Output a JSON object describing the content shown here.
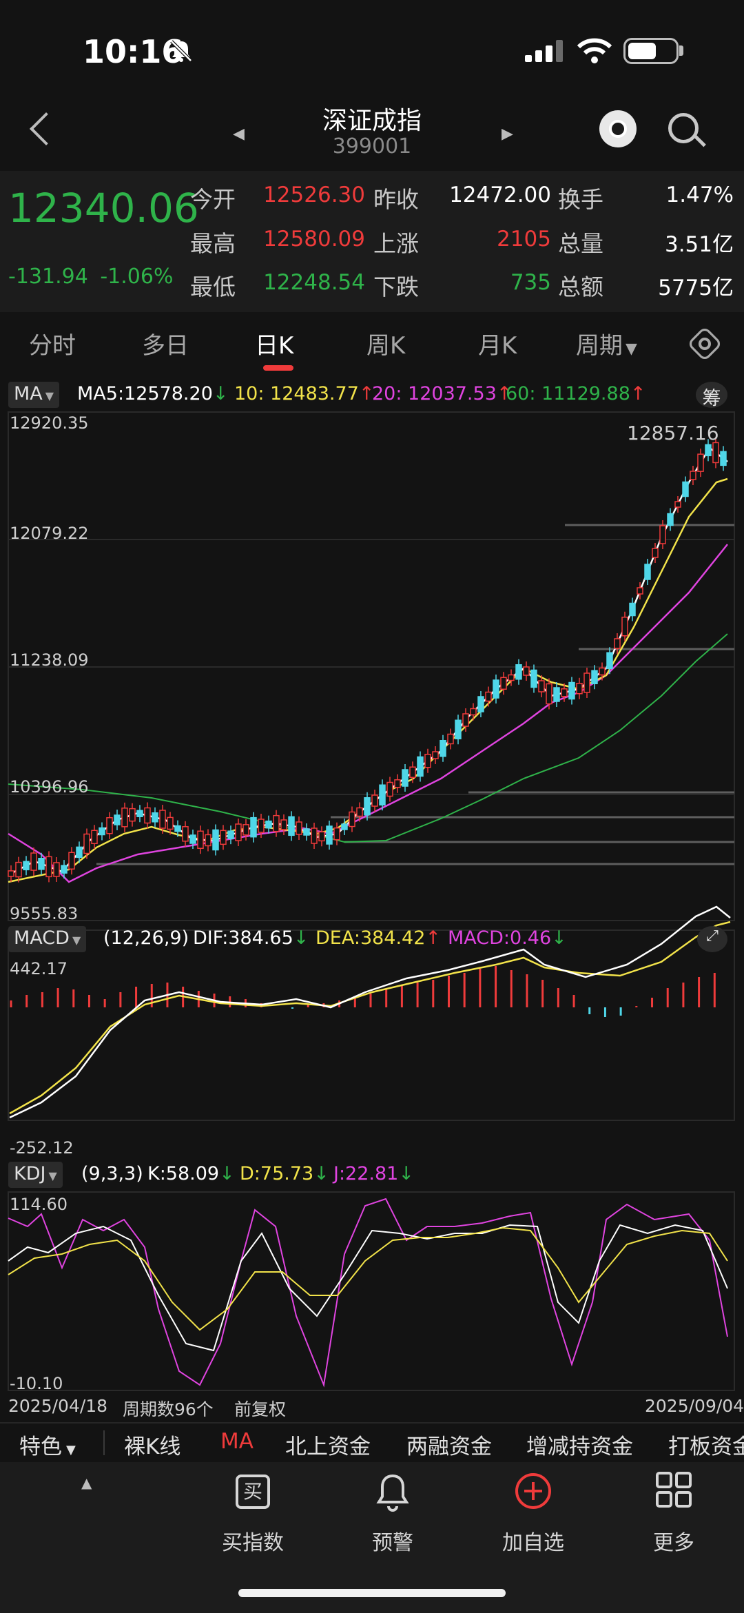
{
  "status": {
    "time": "10:16"
  },
  "nav": {
    "title": "深证成指",
    "code": "399001"
  },
  "quote": {
    "price": "12340.06",
    "change": "-131.94",
    "change_pct": "-1.06%",
    "open_label": "今开",
    "open": "12526.30",
    "high_label": "最高",
    "high": "12580.09",
    "low_label": "最低",
    "low": "12248.54",
    "prev_close_label": "昨收",
    "prev_close": "12472.00",
    "up_label": "上涨",
    "up": "2105",
    "down_label": "下跌",
    "down": "735",
    "turnover_label": "换手",
    "turnover": "1.47%",
    "volume_label": "总量",
    "volume": "3.51亿",
    "amount_label": "总额",
    "amount": "5775亿"
  },
  "tabs": [
    {
      "label": "分时"
    },
    {
      "label": "多日"
    },
    {
      "label": "日K"
    },
    {
      "label": "周K"
    },
    {
      "label": "月K"
    },
    {
      "label": "周期"
    }
  ],
  "ma_row": {
    "btn": "MA",
    "ma5": "MA5:12578.20",
    "ma5_arrow": "↓",
    "ma10": "10: 12483.77",
    "ma10_arrow": "↑",
    "ma20": "20: 12037.53",
    "ma20_arrow": "↑",
    "ma60": "60: 11129.88",
    "ma60_arrow": "↑",
    "chip_btn": "筹"
  },
  "price_axis": {
    "top": "12920.35",
    "l2": "12079.22",
    "l3": "11238.09",
    "l4": "10396.96",
    "bottom": "9555.83",
    "max_marker": "12857.16"
  },
  "macd_row": {
    "btn": "MACD",
    "params": "(12,26,9)",
    "dif": "DIF:384.65",
    "dif_arrow": "↓",
    "dea": "DEA:384.42",
    "dea_arrow": "↑",
    "macd": "MACD:0.46",
    "macd_arrow": "↓"
  },
  "macd_axis": {
    "top": "442.17",
    "bottom": "-252.12"
  },
  "kdj_row": {
    "btn": "KDJ",
    "params": "(9,3,3)",
    "k": "K:58.09",
    "k_arrow": "↓",
    "d": "D:75.73",
    "d_arrow": "↓",
    "j": "J:22.81",
    "j_arrow": "↓"
  },
  "kdj_axis": {
    "top": "114.60",
    "bottom": "-10.10"
  },
  "footer_info": {
    "date_start": "2025/04/18",
    "period_count": "周期数96个",
    "adjust": "前复权",
    "date_end": "2025/09/04"
  },
  "features": [
    "特色",
    "裸K线",
    "MA",
    "北上资金",
    "两融资金",
    "增减持资金",
    "打板资金"
  ],
  "bottom_nav": [
    {
      "label": "买指数",
      "icon": "buy-index-icon",
      "glyph": "买"
    },
    {
      "label": "预警",
      "icon": "bell-icon"
    },
    {
      "label": "加自选",
      "icon": "add-watchlist-icon"
    },
    {
      "label": "更多",
      "icon": "grid-icon"
    }
  ],
  "colors": {
    "up": "#ef3b3b",
    "down": "#4fd6e8",
    "ma5": "#ffffff",
    "ma10": "#f2e34a",
    "ma20": "#e044e0",
    "ma60": "#2fb34a"
  },
  "chart_data": {
    "type": "candlestick",
    "ylim": [
      9555.83,
      12920.35
    ],
    "bars": [
      10,
      18,
      22,
      28,
      26,
      18,
      12,
      22,
      30,
      34,
      36,
      30,
      24,
      20,
      16,
      12,
      6,
      0,
      -2,
      4,
      6,
      10,
      14,
      20,
      26,
      32,
      36,
      40,
      46,
      50,
      56,
      60,
      54,
      48,
      40,
      28,
      18,
      -10,
      -14,
      -12,
      2,
      14,
      28,
      36,
      44,
      50
    ]
  }
}
